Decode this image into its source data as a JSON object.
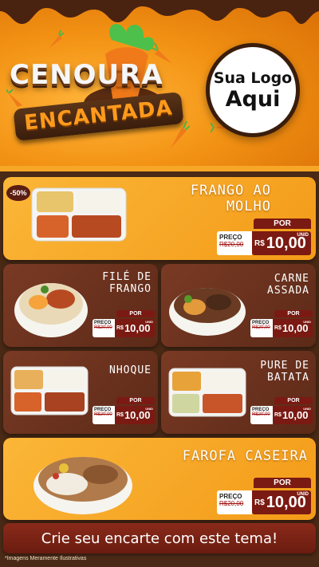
{
  "hero": {
    "title_main": "CENOURA",
    "title_sub": "ENCANTADA",
    "logo_line1": "Sua Logo",
    "logo_line2": "Aqui"
  },
  "discount": "-50%",
  "items": [
    {
      "name_line1": "FRANGO AO",
      "name_line2": "MOLHO",
      "por": "POR",
      "old_label": "PREÇO",
      "old_price": "R$20,00",
      "currency": "R$",
      "price": "10,00",
      "unit": "UNID"
    },
    {
      "name_line1": "FILÉ DE",
      "name_line2": "FRANGO",
      "por": "POR",
      "old_label": "PREÇO",
      "old_price": "R$20,00",
      "currency": "R$",
      "price": "10,00",
      "unit": "UNID"
    },
    {
      "name_line1": "CARNE",
      "name_line2": "ASSADA",
      "por": "POR",
      "old_label": "PREÇO",
      "old_price": "R$20,00",
      "currency": "R$",
      "price": "10,00",
      "unit": "UNID"
    },
    {
      "name_line1": "NHOQUE",
      "name_line2": "",
      "por": "POR",
      "old_label": "PREÇO",
      "old_price": "R$20,00",
      "currency": "R$",
      "price": "10,00",
      "unit": "UNID"
    },
    {
      "name_line1": "PURE DE",
      "name_line2": "BATATA",
      "por": "POR",
      "old_label": "PREÇO",
      "old_price": "R$20,00",
      "currency": "R$",
      "price": "10,00",
      "unit": "UNID"
    },
    {
      "name_line1": "FAROFA CASEIRA",
      "name_line2": "",
      "por": "POR",
      "old_label": "PREÇO",
      "old_price": "R$20,00",
      "currency": "R$",
      "price": "10,00",
      "unit": "UNID"
    }
  ],
  "cta": "Crie seu encarte com este tema!",
  "disclaimer": "*Imagens Meramente Ilustrativas",
  "colors": {
    "orange": "#f5a21f",
    "brown": "#6a2e1c",
    "price_red": "#7a1a12",
    "background": "#4a2a16"
  }
}
